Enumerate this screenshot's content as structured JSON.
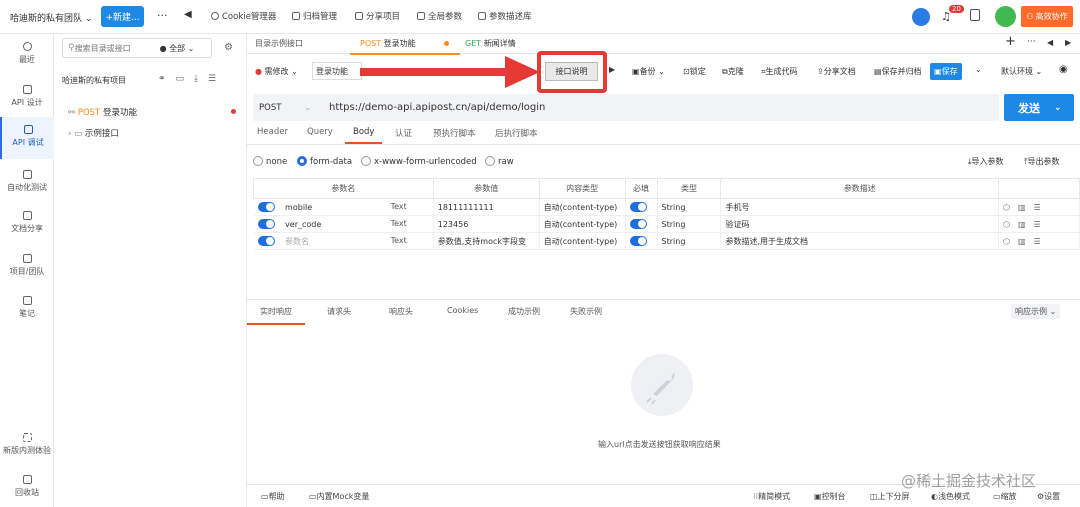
{
  "topbar": {
    "team_name": "哈迪斯的私有团队",
    "new_button": "+新建...",
    "more": "···",
    "tabs": [
      "Cookie管理器",
      "归档管理",
      "分享项目",
      "全局参数",
      "参数描述库"
    ],
    "notification_count": "20",
    "upgrade_button": "高效协作"
  },
  "sidebar": {
    "items": [
      "最近",
      "API 设计",
      "API 调试",
      "自动化测试",
      "文档分享",
      "项目/团队",
      "笔记"
    ],
    "bottom_items": [
      "新版内测体验",
      "回收站"
    ]
  },
  "tree": {
    "search_placeholder": "搜索目录或接口",
    "filter": "全部",
    "project_name": "哈迪斯的私有项目",
    "items": [
      {
        "method": "POST",
        "name": "登录功能"
      },
      {
        "name": "示例接口"
      }
    ]
  },
  "main": {
    "tabs": [
      {
        "label": "目录示例接口"
      },
      {
        "method": "POST",
        "label": "登录功能"
      },
      {
        "method": "GET",
        "label": "新闻详情"
      }
    ],
    "toolbar": {
      "status": "需修改",
      "title": "登录功能",
      "doc_button": "接口说明",
      "items": [
        "备份",
        "锁定",
        "克隆",
        "生成代码",
        "分享文档",
        "保存并归档",
        "保存"
      ],
      "env": "默认环境"
    },
    "request": {
      "method": "POST",
      "url": "https://demo-api.apipost.cn/api/demo/login",
      "send_label": "发送"
    },
    "subtabs": [
      "Header",
      "Query",
      "Body",
      "认证",
      "预执行脚本",
      "后执行脚本"
    ],
    "body_types": [
      "none",
      "form-data",
      "x-www-form-urlencoded",
      "raw"
    ],
    "import_label": "导入参数",
    "export_label": "导出参数",
    "table": {
      "headers": [
        "参数名",
        "参数值",
        "内容类型",
        "必填",
        "类型",
        "参数描述"
      ],
      "rows": [
        {
          "name": "mobile",
          "kind": "Text",
          "value": "18111111111",
          "ctype": "自动(content-type)",
          "type": "String",
          "desc": "手机号"
        },
        {
          "name": "ver_code",
          "kind": "Text",
          "value": "123456",
          "ctype": "自动(content-type)",
          "type": "String",
          "desc": "验证码"
        },
        {
          "name": "参数名",
          "kind": "Text",
          "value": "参数值,支持mock字段变",
          "ctype": "自动(content-type)",
          "type": "String",
          "desc": "参数描述,用于生成文档"
        }
      ]
    },
    "response_tabs": [
      "实时响应",
      "请求头",
      "响应头",
      "Cookies",
      "成功示例",
      "失败示例"
    ],
    "response_example": "响应示例",
    "empty_hint": "输入url点击发送按钮获取响应结果",
    "statusbar": {
      "left": [
        "帮助",
        "内置Mock变量"
      ],
      "right": [
        "精简模式",
        "控制台",
        "上下分屏",
        "浅色模式",
        "缩放",
        "设置"
      ]
    },
    "watermark": "@稀土掘金技术社区"
  },
  "colors": {
    "primary": "#1e88e5",
    "accent": "#ff6b2b",
    "annotation": "#e53935",
    "post": "#ff8c1a",
    "get": "#2eaa5c"
  }
}
